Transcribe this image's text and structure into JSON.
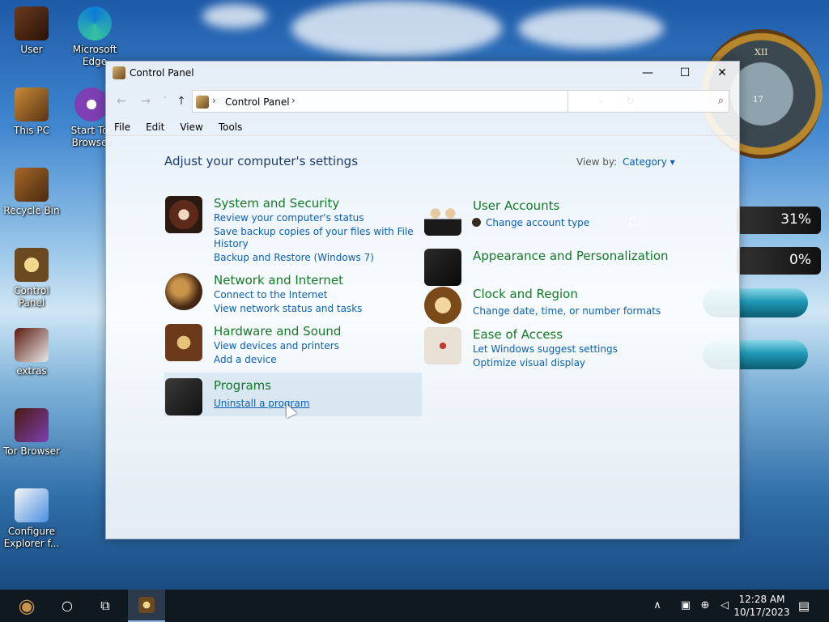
{
  "desktop": {
    "icons": [
      {
        "label": "User",
        "icon": "user-folder-icon"
      },
      {
        "label": "Microsoft Edge",
        "icon": "edge-icon"
      },
      {
        "label": "This PC",
        "icon": "computer-icon"
      },
      {
        "label": "Start Tor Browser",
        "icon": "tor-icon"
      },
      {
        "label": "Recycle Bin",
        "icon": "recycle-bin-icon"
      },
      {
        "label": "Control Panel",
        "icon": "control-panel-icon"
      },
      {
        "label": "extras",
        "icon": "folder-icon"
      },
      {
        "label": "Tor Browser",
        "icon": "tor-folder-icon"
      },
      {
        "label": "Configure Explorer f...",
        "icon": "shield-icon"
      }
    ],
    "gadgets": {
      "clock_date": "17",
      "cpu_percent": "31%",
      "disk_percent": "0%",
      "cpu_label": "C:"
    }
  },
  "window": {
    "title": "Control Panel",
    "controls": {
      "minimize": "—",
      "maximize": "☐",
      "close": "✕"
    },
    "address": {
      "back": "←",
      "forward": "→",
      "recent": "˅",
      "up": "↑",
      "crumb": "Control Panel",
      "chev1": "›",
      "chev2": "›",
      "dropdown": "⌄",
      "refresh": "↻",
      "search_placeholder": "",
      "search_icon": "⌕"
    },
    "menu": [
      "File",
      "Edit",
      "View",
      "Tools"
    ],
    "heading": "Adjust your computer's settings",
    "view_by_label": "View by:",
    "view_by_value": "Category ▾",
    "categories": {
      "system": {
        "title": "System and Security",
        "links": [
          "Review your computer's status",
          "Save backup copies of your files with File",
          "History",
          "Backup and Restore (Windows 7)"
        ]
      },
      "network": {
        "title": "Network and Internet",
        "links": [
          "Connect to the Internet",
          "View network status and tasks"
        ]
      },
      "hardware": {
        "title": "Hardware and Sound",
        "links": [
          "View devices and printers",
          "Add a device"
        ]
      },
      "programs": {
        "title": "Programs",
        "links": [
          "Uninstall a program"
        ]
      },
      "users": {
        "title": "User Accounts",
        "links": [
          "Change account type"
        ]
      },
      "appearance": {
        "title": "Appearance and Personalization",
        "links": []
      },
      "clock": {
        "title": "Clock and Region",
        "links": [
          "Change date, time, or number formats"
        ]
      },
      "ease": {
        "title": "Ease of Access",
        "links": [
          "Let Windows suggest settings",
          "Optimize visual display"
        ]
      }
    }
  },
  "taskbar": {
    "start": "◉",
    "search": "○",
    "taskview": "⧉",
    "tray_chevron": "∧",
    "time": "12:28 AM",
    "date": "10/17/2023",
    "notifications": "▤"
  }
}
